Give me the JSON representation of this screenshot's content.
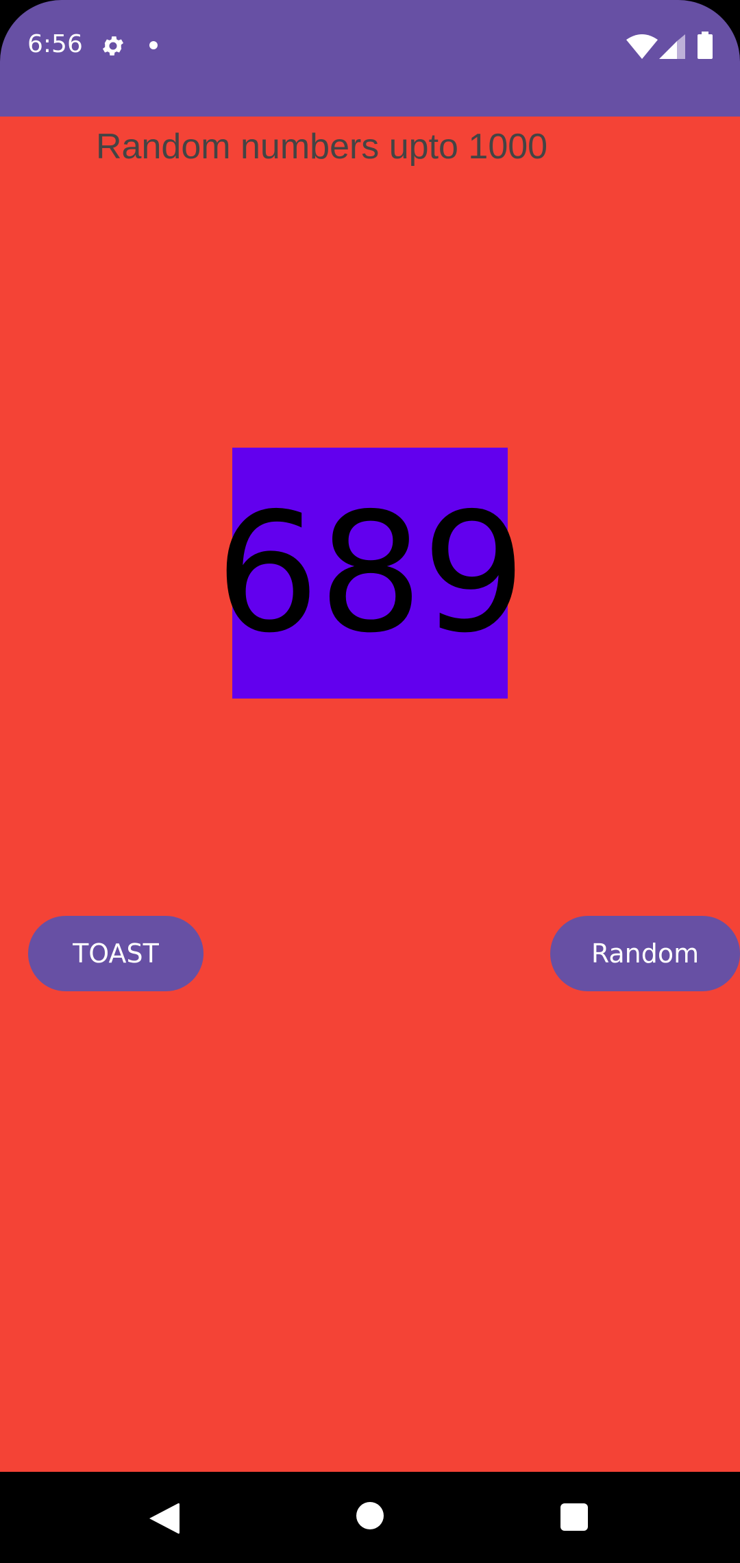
{
  "status_bar": {
    "time": "6:56",
    "icons": [
      "gear-icon",
      "notification-dot-icon",
      "wifi-icon",
      "signal-icon",
      "battery-icon"
    ],
    "bg_color": "#6750A4"
  },
  "app": {
    "bg_color": "#F44336",
    "heading": "Random numbers upto 1000",
    "number_display": "689",
    "number_box_color": "#6200EE",
    "buttons": {
      "toast_label": "TOAST",
      "random_label": "Random"
    },
    "button_color": "#6750A4"
  },
  "nav_bar": {
    "icons": [
      "back-icon",
      "home-icon",
      "recent-apps-icon"
    ]
  }
}
